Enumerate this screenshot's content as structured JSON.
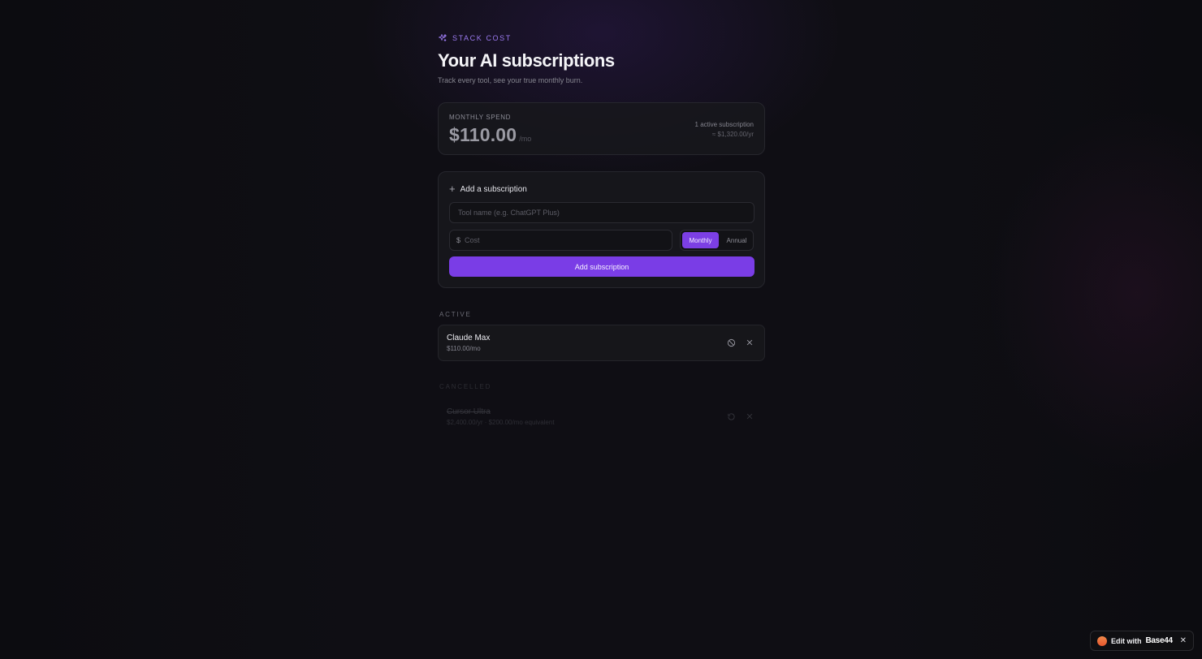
{
  "brand": {
    "label": "STACK COST",
    "icon": "sparkles-icon"
  },
  "header": {
    "title": "Your AI subscriptions",
    "subtitle": "Track every tool, see your true monthly burn."
  },
  "summary": {
    "label": "MONTHLY SPEND",
    "amount": "$110.00",
    "unit": "/mo",
    "active_count": "1 active subscription",
    "annual_equivalent": "≈ $1,320.00/yr"
  },
  "add_form": {
    "heading": "Add a subscription",
    "name_placeholder": "Tool name (e.g. ChatGPT Plus)",
    "currency_symbol": "$",
    "cost_placeholder": "Cost",
    "billing_options": [
      "Monthly",
      "Annual"
    ],
    "selected_billing": "Monthly",
    "submit_label": "Add subscription",
    "accent_color": "#7a3de6"
  },
  "active": {
    "label": "ACTIVE",
    "items": [
      {
        "name": "Claude Max",
        "price": "$110.00/mo"
      }
    ]
  },
  "cancelled": {
    "label": "CANCELLED",
    "items": [
      {
        "name": "Cursor Ultra",
        "price": "$2,400.00/yr · $200.00/mo equivalent"
      }
    ]
  },
  "badge": {
    "prefix": "Edit with",
    "brand": "Base44",
    "close": "✕"
  }
}
